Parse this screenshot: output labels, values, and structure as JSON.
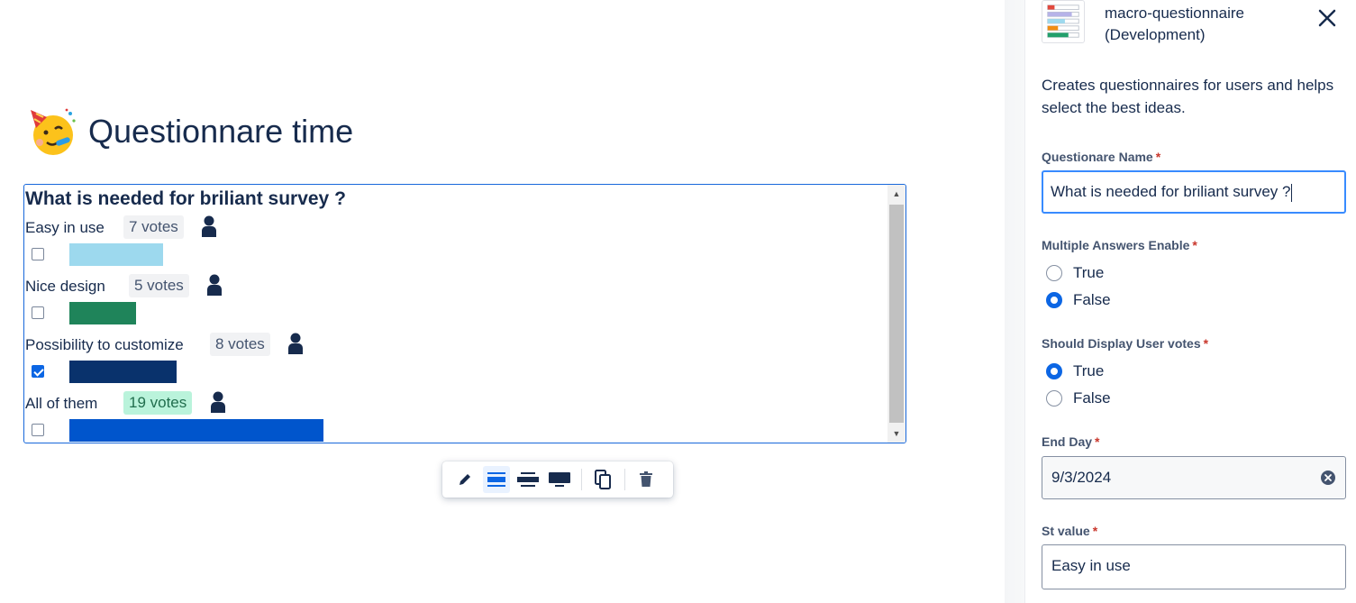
{
  "page": {
    "title": "Questionnare time",
    "title_emoji": "partying-face"
  },
  "questionnaire": {
    "question": "What is needed for briliant survey ?",
    "options": [
      {
        "label": "Easy in use",
        "votes": "7 votes",
        "vote_count": 7,
        "checked": false,
        "color": "#9dd9ee",
        "leading": false
      },
      {
        "label": "Nice design",
        "votes": "5 votes",
        "vote_count": 5,
        "checked": false,
        "color": "#1f845a",
        "leading": false
      },
      {
        "label": "Possibility to customize",
        "votes": "8 votes",
        "vote_count": 8,
        "checked": true,
        "color": "#09326c",
        "leading": false
      },
      {
        "label": "All of them",
        "votes": "19 votes",
        "vote_count": 19,
        "checked": false,
        "color": "#0055cc",
        "leading": true
      }
    ],
    "icons": {
      "voters": "user-icon"
    }
  },
  "toolbar": {
    "buttons": [
      "edit-icon",
      "layout-center-icon",
      "layout-wide-icon",
      "layout-full-width-icon",
      "copy-icon",
      "delete-icon"
    ],
    "active": "layout-center-icon"
  },
  "panel": {
    "app_name_line1": "macro-questionnaire",
    "app_name_line2": "(Development)",
    "description": "Creates questionnaires for users and helps select the best ideas.",
    "fields": {
      "name_label": "Questionare Name",
      "name_value": "What is needed for briliant survey ?",
      "multiple_label": "Multiple Answers Enable",
      "multiple_options": [
        "True",
        "False"
      ],
      "multiple_selected": "False",
      "display_votes_label": "Should Display User votes",
      "display_votes_options": [
        "True",
        "False"
      ],
      "display_votes_selected": "True",
      "end_day_label": "End Day",
      "end_day_value": "9/3/2024",
      "st_value_label": "St value",
      "st_value_value": "Easy in use"
    },
    "required_marker": "*"
  },
  "colors": {
    "accent": "#0c66e4",
    "focus": "#388bff",
    "text": "#172b4d",
    "required": "#c9372c"
  }
}
